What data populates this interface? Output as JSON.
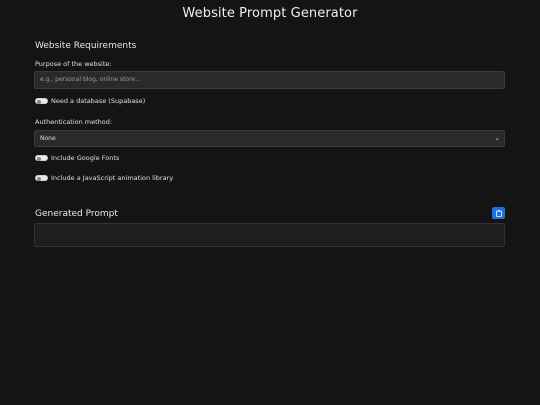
{
  "page": {
    "title": "Website Prompt Generator"
  },
  "requirements": {
    "heading": "Website Requirements",
    "purpose_label": "Purpose of the website:",
    "purpose_placeholder": "e.g., personal blog, online store...",
    "purpose_value": "",
    "database_toggle_label": "Need a database (Supabase)",
    "database_toggle_on": false,
    "auth_label": "Authentication method:",
    "auth_selected": "None",
    "google_fonts_label": "Include Google Fonts",
    "google_fonts_on": false,
    "animation_label": "Include a JavaScript animation library",
    "animation_on": false
  },
  "output": {
    "heading": "Generated Prompt",
    "copy_icon": "clipboard-icon",
    "prompt_text": ""
  },
  "colors": {
    "background": "#141414",
    "accent": "#1f6fe0",
    "input_bg": "#2a2a2a"
  }
}
